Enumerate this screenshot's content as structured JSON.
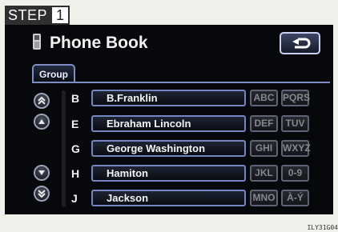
{
  "step": {
    "label": "STEP",
    "number": "1"
  },
  "header": {
    "title": "Phone Book",
    "back_icon": "return-arrow-icon"
  },
  "group_tab": "Group",
  "contacts": [
    {
      "letter": "B",
      "name": "B.Franklin"
    },
    {
      "letter": "E",
      "name": "Ebraham Lincoln"
    },
    {
      "letter": "G",
      "name": "George Washington"
    },
    {
      "letter": "H",
      "name": "Hamiton"
    },
    {
      "letter": "J",
      "name": "Jackson"
    }
  ],
  "index_keys": [
    [
      "ABC",
      "PQRS"
    ],
    [
      "DEF",
      "TUV"
    ],
    [
      "GHI",
      "WXYZ"
    ],
    [
      "JKL",
      "0-9"
    ],
    [
      "MNO",
      "À-Ý"
    ]
  ],
  "scroll_icons": [
    "page-up-icon",
    "up-icon",
    "down-icon",
    "page-down-icon"
  ],
  "figure_code": "ILY31G04"
}
